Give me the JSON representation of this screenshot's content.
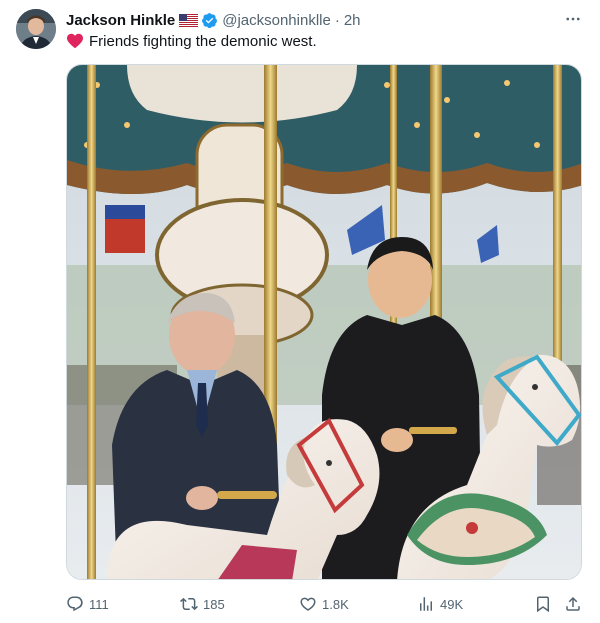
{
  "author": {
    "name": "Jackson Hinkle",
    "handle": "@jacksonhinklle",
    "separator": "·",
    "time": "2h",
    "flag_icon": "us-flag-icon",
    "verified_icon": "verified-badge-icon"
  },
  "tweet": {
    "emoji_icon": "red-heart-icon",
    "text": "Friends fighting the demonic west."
  },
  "metrics": {
    "replies": "111",
    "retweets": "185",
    "likes": "1.8K",
    "views": "49K"
  },
  "colors": {
    "text_primary": "#0f1419",
    "text_secondary": "#536471",
    "verified_blue": "#1d9bf0",
    "heart_red": "#e0245e",
    "border": "#cfd9de"
  }
}
